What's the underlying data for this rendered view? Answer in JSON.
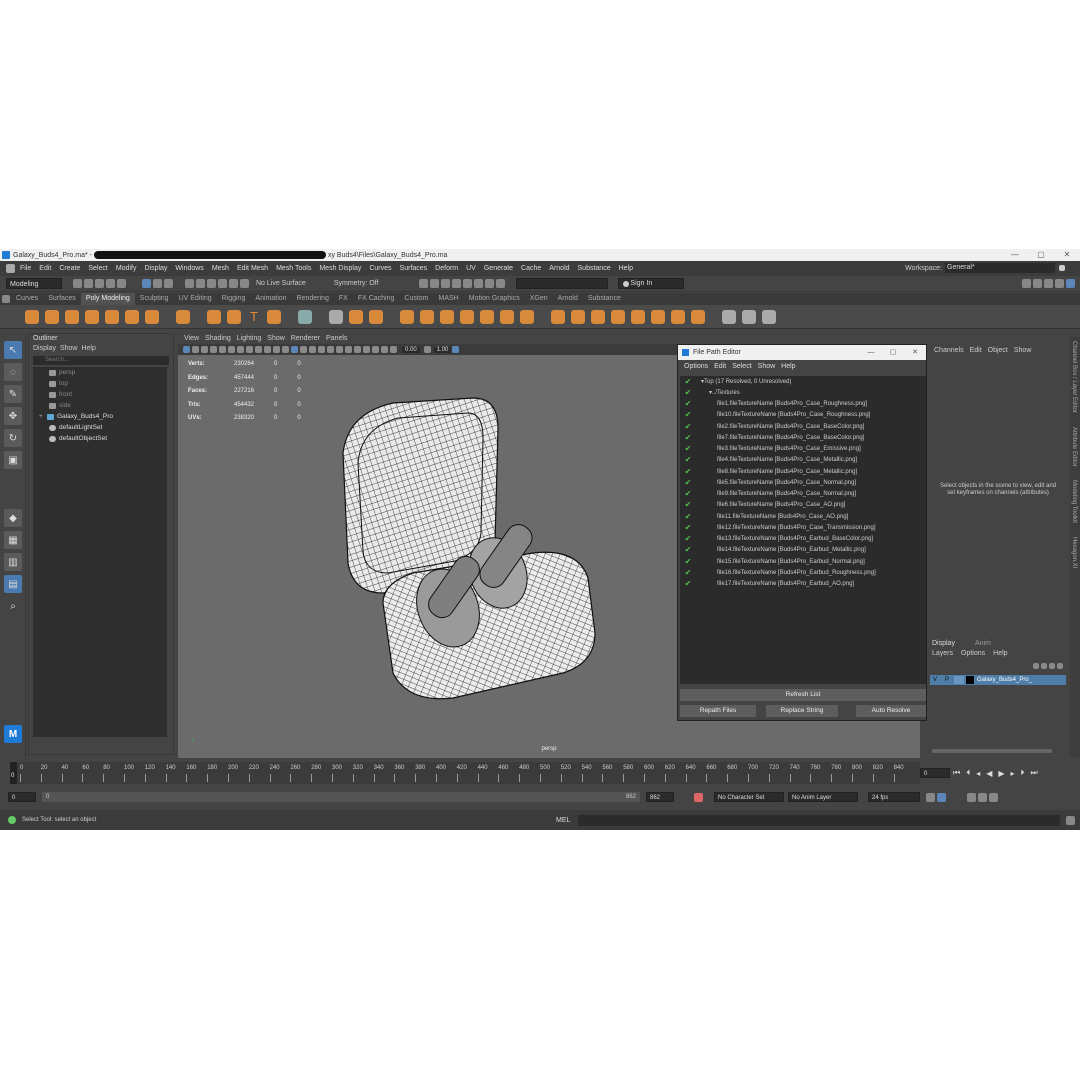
{
  "window": {
    "title_left": "Galaxy_Buds4_Pro.ma* - ",
    "title_right": "xy Buds4\\Files\\Galaxy_Buds4_Pro.ma",
    "min": "—",
    "max": "▢",
    "close": "✕"
  },
  "menu": [
    "File",
    "Edit",
    "Create",
    "Select",
    "Modify",
    "Display",
    "Windows",
    "Mesh",
    "Edit Mesh",
    "Mesh Tools",
    "Mesh Display",
    "Curves",
    "Surfaces",
    "Deform",
    "UV",
    "Generate",
    "Cache",
    "Arnold",
    "Substance",
    "Help"
  ],
  "workspace": {
    "label": "Workspace:",
    "value": "General*"
  },
  "statusline": {
    "mode": "Modeling",
    "live_surface": "No Live Surface",
    "symmetry": "Symmetry: Off",
    "sign_in": "Sign In"
  },
  "shelf_tabs": [
    "Curves",
    "Surfaces",
    "Poly Modeling",
    "Sculpting",
    "UV Editing",
    "Rigging",
    "Animation",
    "Rendering",
    "FX",
    "FX Caching",
    "Custom",
    "MASH",
    "Motion Graphics",
    "XGen",
    "Arnold",
    "Substance"
  ],
  "shelf_active": "Poly Modeling",
  "outliner": {
    "title": "Outliner",
    "menu": [
      "Display",
      "Show",
      "Help"
    ],
    "search_placeholder": "Search...",
    "items": [
      {
        "label": "persp",
        "dim": true
      },
      {
        "label": "top",
        "dim": true
      },
      {
        "label": "front",
        "dim": true
      },
      {
        "label": "side",
        "dim": true
      },
      {
        "label": "Galaxy_Buds4_Pro",
        "dim": false
      },
      {
        "label": "defaultLightSet",
        "dim": false
      },
      {
        "label": "defaultObjectSet",
        "dim": false
      }
    ]
  },
  "viewport": {
    "menu": [
      "View",
      "Shading",
      "Lighting",
      "Show",
      "Renderer",
      "Panels"
    ],
    "camera": "persp",
    "val1": "0.00",
    "val2": "1.00",
    "hud": [
      {
        "k": "Verts:",
        "v": "230264",
        "a": "0",
        "b": "0"
      },
      {
        "k": "Edges:",
        "v": "457444",
        "a": "0",
        "b": "0"
      },
      {
        "k": "Faces:",
        "v": "227216",
        "a": "0",
        "b": "0"
      },
      {
        "k": "Tris:",
        "v": "454432",
        "a": "0",
        "b": "0"
      },
      {
        "k": "UVs:",
        "v": "238320",
        "a": "0",
        "b": "0"
      }
    ]
  },
  "file_path_editor": {
    "title": "File Path Editor",
    "menu": [
      "Options",
      "Edit",
      "Select",
      "Show",
      "Help"
    ],
    "rows": [
      "Top (17 Resolved, 0 Unresolved)",
      "../Textures",
      "file1.fileTextureName [Buds4Pro_Case_Roughness.png]",
      "file10.fileTextureName [Buds4Pro_Case_Roughness.png]",
      "file2.fileTextureName [Buds4Pro_Case_BaseColor.png]",
      "file7.fileTextureName [Buds4Pro_Case_BaseColor.png]",
      "file3.fileTextureName [Buds4Pro_Case_Emissive.png]",
      "file4.fileTextureName [Buds4Pro_Case_Metallic.png]",
      "file8.fileTextureName [Buds4Pro_Case_Metallic.png]",
      "file5.fileTextureName [Buds4Pro_Case_Normal.png]",
      "file9.fileTextureName [Buds4Pro_Case_Normal.png]",
      "file6.fileTextureName [Buds4Pro_Case_AO.png]",
      "file11.fileTextureName [Buds4Pro_Case_AO.png]",
      "file12.fileTextureName [Buds4Pro_Case_Transmission.png]",
      "file13.fileTextureName [Buds4Pro_Earbud_BaseColor.png]",
      "file14.fileTextureName [Buds4Pro_Earbud_Metallic.png]",
      "file15.fileTextureName [Buds4Pro_Earbud_Normal.png]",
      "file16.fileTextureName [Buds4Pro_Earbud_Roughness.png]",
      "file17.fileTextureName [Buds4Pro_Earbud_AO.png]"
    ],
    "refresh": "Refresh List",
    "repath": "Repath Files",
    "replace": "Replace String",
    "auto": "Auto Resolve"
  },
  "channel_box": {
    "menu": [
      "Channels",
      "Edit",
      "Object",
      "Show"
    ],
    "empty_msg": "Select objects in the scene to view, edit and set keyframes on channels (attributes)",
    "layer_tabs": [
      "Display",
      "Anim"
    ],
    "layer_menu": [
      "Layers",
      "Options",
      "Help"
    ],
    "layer_v": "V",
    "layer_p": "P",
    "layer_name": "Galaxy_Buds4_Pro_"
  },
  "side_tabs": [
    "Channel Box / Layer Editor",
    "Attribute Editor",
    "Modeling Toolkit",
    "Hexagon.XI"
  ],
  "timeline": {
    "ticks": [
      "0",
      "20",
      "40",
      "60",
      "80",
      "100",
      "120",
      "140",
      "160",
      "180",
      "200",
      "220",
      "240",
      "260",
      "280",
      "300",
      "320",
      "340",
      "360",
      "380",
      "400",
      "420",
      "440",
      "460",
      "480",
      "500",
      "520",
      "540",
      "560",
      "580",
      "600",
      "620",
      "640",
      "660",
      "680",
      "700",
      "720",
      "740",
      "760",
      "780",
      "800",
      "820",
      "840"
    ],
    "current": "0",
    "frame_field": "0"
  },
  "range": {
    "start": "0",
    "inner_start": "0",
    "inner_end": "862",
    "end": "862",
    "character_set": "No Character Set",
    "anim_layer": "No Anim Layer",
    "fps": "24 fps"
  },
  "cmdline": {
    "help": "Select Tool: select an object",
    "lang": "MEL"
  }
}
